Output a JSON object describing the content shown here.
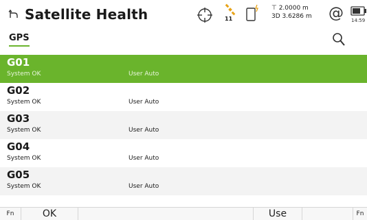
{
  "header": {
    "title": "Satellite Health",
    "icons": {
      "back": "back-arrow-icon",
      "crosshair": "crosshair-icon",
      "satellite": "satellite-icon",
      "device": "controller-device-icon",
      "at": "at-icon",
      "battery": "battery-icon"
    },
    "satellite_count": "11",
    "position_quality_1": "⊤ 2.0000 m",
    "position_quality_2": "3D 3.6286 m",
    "at_symbol": "@",
    "time": "14:59",
    "accent_color": "#e8a317"
  },
  "tabs": {
    "active": "GPS",
    "search_icon": "search-icon"
  },
  "satellites": [
    {
      "name": "G01",
      "system": "System  OK",
      "user": "User  Auto",
      "selected": true
    },
    {
      "name": "G02",
      "system": "System  OK",
      "user": "User  Auto",
      "selected": false
    },
    {
      "name": "G03",
      "system": "System  OK",
      "user": "User  Auto",
      "selected": false
    },
    {
      "name": "G04",
      "system": "System  OK",
      "user": "User  Auto",
      "selected": false
    },
    {
      "name": "G05",
      "system": "System  OK",
      "user": "User  Auto",
      "selected": false
    }
  ],
  "footer": {
    "fn_left": "Fn",
    "ok": "OK",
    "use": "Use",
    "fn_right": "Fn"
  },
  "colors": {
    "selection": "#6ab42c",
    "alt_row": "#f3f3f3"
  }
}
